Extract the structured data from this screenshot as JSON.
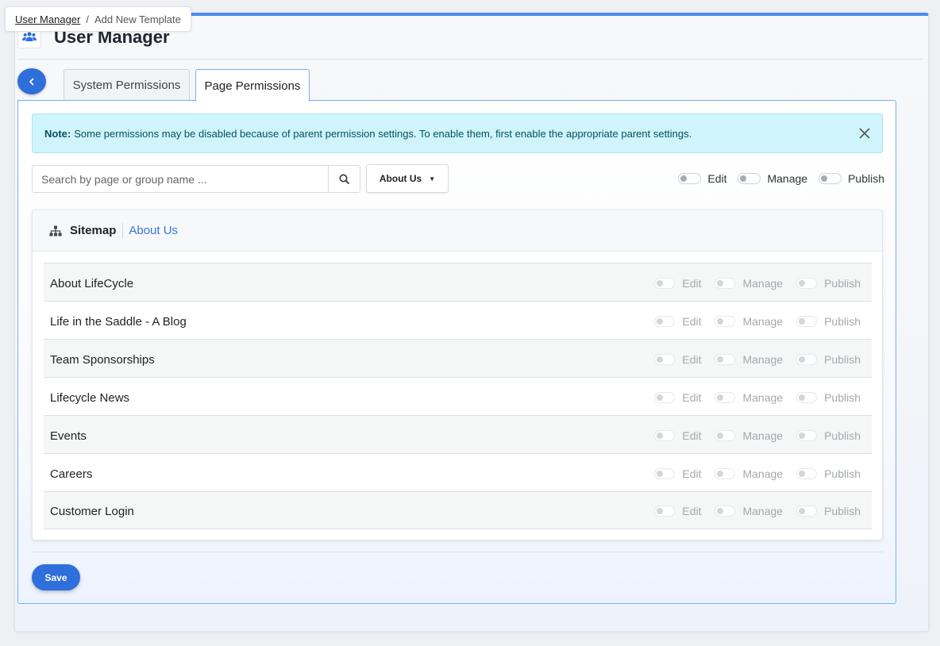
{
  "breadcrumb": {
    "items": [
      "User Manager",
      "Add New Template"
    ],
    "separator": "/"
  },
  "header": {
    "title": "User Manager",
    "icon": "users-icon"
  },
  "tabs": [
    {
      "label": "System Permissions",
      "active": false
    },
    {
      "label": "Page Permissions",
      "active": true
    }
  ],
  "note": {
    "label": "Note:",
    "text": "Some permissions may be disabled because of parent permission settings. To enable them, first enable the appropriate parent settings."
  },
  "search": {
    "placeholder": "Search by page or group name ...",
    "value": ""
  },
  "dropdown": {
    "selected": "About Us"
  },
  "global_toggles": {
    "edit": "Edit",
    "manage": "Manage",
    "publish": "Publish"
  },
  "sitemap": {
    "title": "Sitemap",
    "current": "About Us"
  },
  "pages": [
    {
      "name": "About LifeCycle",
      "edit": "Edit",
      "manage": "Manage",
      "publish": "Publish"
    },
    {
      "name": "Life in the Saddle - A Blog",
      "edit": "Edit",
      "manage": "Manage",
      "publish": "Publish"
    },
    {
      "name": "Team Sponsorships",
      "edit": "Edit",
      "manage": "Manage",
      "publish": "Publish"
    },
    {
      "name": "Lifecycle News",
      "edit": "Edit",
      "manage": "Manage",
      "publish": "Publish"
    },
    {
      "name": "Events",
      "edit": "Edit",
      "manage": "Manage",
      "publish": "Publish"
    },
    {
      "name": "Careers",
      "edit": "Edit",
      "manage": "Manage",
      "publish": "Publish"
    },
    {
      "name": "Customer Login",
      "edit": "Edit",
      "manage": "Manage",
      "publish": "Publish"
    }
  ],
  "actions": {
    "save": "Save"
  },
  "colors": {
    "accent": "#2f6fdc",
    "note_bg": "#cff4fc",
    "link": "#3577d4"
  }
}
